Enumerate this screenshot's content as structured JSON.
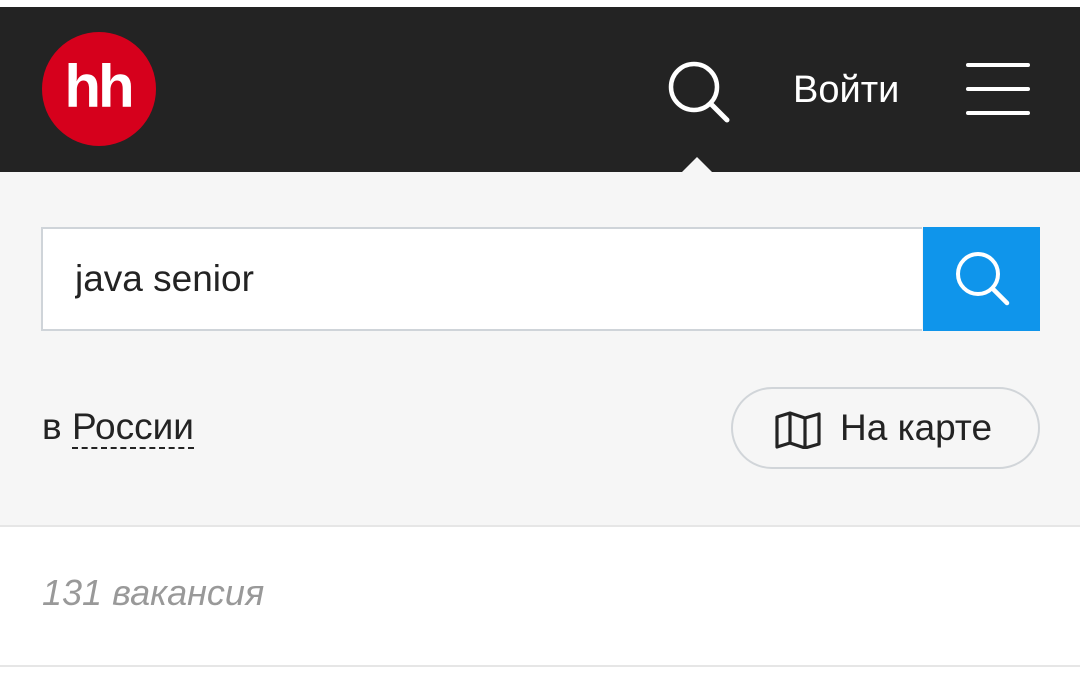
{
  "header": {
    "logo_text": "hh",
    "login_label": "Войти",
    "icons": {
      "search": "search-icon",
      "menu": "hamburger-menu-icon"
    },
    "background_color": "#232323",
    "logo_color": "#d6001c"
  },
  "search": {
    "query": "java senior",
    "button_icon": "search-icon",
    "button_color": "#0f95eb"
  },
  "region": {
    "prefix": "в",
    "name": "России"
  },
  "map_button": {
    "label": "На карте",
    "icon": "map-icon"
  },
  "results": {
    "count_text": "131 вакансия"
  }
}
